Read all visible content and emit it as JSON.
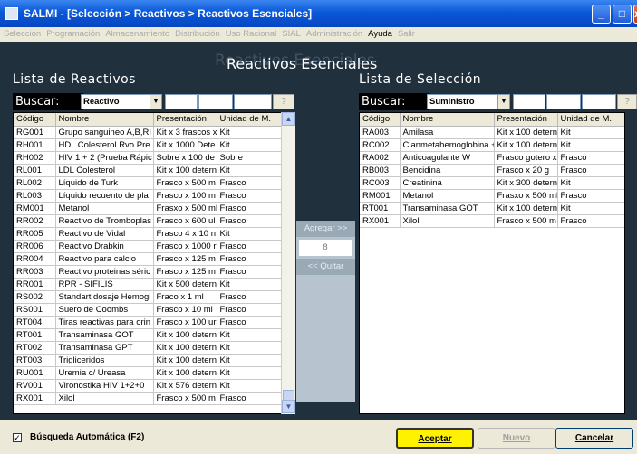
{
  "window": {
    "title": "SALMI - [Selección > Reactivos > Reactivos Esenciales]",
    "minimize": "_",
    "maximize": "□",
    "close": "x"
  },
  "menu": [
    {
      "label": "Selección",
      "enabled": false
    },
    {
      "label": "Programación",
      "enabled": false
    },
    {
      "label": "Almacenamiento",
      "enabled": false
    },
    {
      "label": "Distribución",
      "enabled": false
    },
    {
      "label": "Uso Racional",
      "enabled": false
    },
    {
      "label": "SIAL",
      "enabled": false
    },
    {
      "label": "Administración",
      "enabled": false
    },
    {
      "label": "Ayuda",
      "enabled": true
    },
    {
      "label": "Salir",
      "enabled": false
    }
  ],
  "page": {
    "title": "Reactivos Esenciales",
    "title_shadow": "Reactivos Esenciales"
  },
  "left": {
    "title": "Lista de Reactivos",
    "search_label": "Buscar:",
    "search_field": "Reactivo",
    "help_button": "?",
    "columns": [
      "Código",
      "Nombre",
      "Presentación",
      "Unidad de M."
    ],
    "rows": [
      [
        "RG001",
        "Grupo sanguineo A,B,RI",
        "Kit x 3 frascos x",
        "Kit"
      ],
      [
        "RH001",
        "HDL Colesterol Rvo Pre",
        "Kit x 1000 Dete",
        "Kit"
      ],
      [
        "RH002",
        "HIV 1 + 2 (Prueba Rápic",
        "Sobre x 100 de",
        "Sobre"
      ],
      [
        "RL001",
        "LDL Colesterol",
        "Kit x 100 detern",
        "Kit"
      ],
      [
        "RL002",
        "Líquido de Turk",
        "Frasco x 500 m",
        "Frasco"
      ],
      [
        "RL003",
        "Líquido recuento de pla",
        "Frasco x 100 m",
        "Frasco"
      ],
      [
        "RM001",
        "Metanol",
        "Frasxo x 500 ml",
        "Frasco"
      ],
      [
        "RR002",
        "Reactivo de Tromboplas",
        "Frasco x 600 ul",
        "Frasco"
      ],
      [
        "RR005",
        "Reactivo de Vidal",
        "Frasco 4 x 10 n",
        "Kit"
      ],
      [
        "RR006",
        "Reactivo Drabkin",
        "Frasco x 1000 r",
        "Frasco"
      ],
      [
        "RR004",
        "Reactivo para calcio",
        "Frasco x 125 m",
        "Frasco"
      ],
      [
        "RR003",
        "Reactivo proteinas séric",
        "Frasco x 125 m",
        "Frasco"
      ],
      [
        "RR001",
        "RPR - SIFILIS",
        "Kit x 500 detern",
        "Kit"
      ],
      [
        "RS002",
        "Standart dosaje Hemogl",
        "Fraco x 1 ml",
        "Frasco"
      ],
      [
        "RS001",
        "Suero de Coombs",
        "Frasco x 10 ml",
        "Frasco"
      ],
      [
        "RT004",
        "Tiras reactivas para orin",
        "Frasco x 100 ur",
        "Frasco"
      ],
      [
        "RT001",
        "Transaminasa GOT",
        "Kit x 100 detern",
        "Kit"
      ],
      [
        "RT002",
        "Transaminasa GPT",
        "Kit x 100 detern",
        "Kit"
      ],
      [
        "RT003",
        "Trigliceridos",
        "Kit x 100 detern",
        "Kit"
      ],
      [
        "RU001",
        "Uremia c/ Ureasa",
        "Kit x 100 detern",
        "Kit"
      ],
      [
        "RV001",
        "Vironostika HIV 1+2+0",
        "Kit x 576 detern",
        "Kit"
      ],
      [
        "RX001",
        "Xilol",
        "Frasco x 500 m",
        "Frasco"
      ]
    ],
    "scroll_up": "▲",
    "scroll_down": "▼"
  },
  "middle": {
    "add_button": "Agregar >>",
    "count": "8",
    "remove_button": "<< Quitar"
  },
  "right": {
    "title": "Lista de Selección",
    "search_label": "Buscar:",
    "search_field": "Suministro",
    "help_button": "?",
    "columns": [
      "Código",
      "Nombre",
      "Presentación",
      "Unidad de M."
    ],
    "rows": [
      [
        "RA003",
        "Amilasa",
        "Kit x 100 detern",
        "Kit"
      ],
      [
        "RC002",
        "Cianmetahemoglobina +",
        "Kit x 100 detern",
        "Kit"
      ],
      [
        "RA002",
        "Anticoagulante W",
        "Frasco gotero x",
        "Frasco"
      ],
      [
        "RB003",
        "Bencidina",
        "Frasco x 20 g",
        "Frasco"
      ],
      [
        "RC003",
        "Creatinina",
        "Kit x 300 detern",
        "Kit"
      ],
      [
        "RM001",
        "Metanol",
        "Frasxo x 500 ml",
        "Frasco"
      ],
      [
        "RT001",
        "Transaminasa GOT",
        "Kit x 100 detern",
        "Kit"
      ],
      [
        "RX001",
        "Xilol",
        "Frasco x 500 m",
        "Frasco"
      ]
    ]
  },
  "bottom": {
    "auto_search_checked": "✓",
    "auto_search_label": "Búsqueda Automática (F2)",
    "accept_button": "Aceptar",
    "new_button": "Nuevo",
    "cancel_button": "Cancelar"
  }
}
